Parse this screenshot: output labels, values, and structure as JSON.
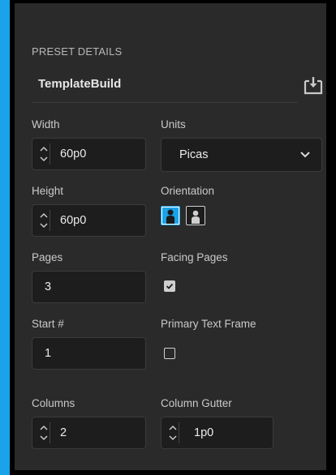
{
  "section": {
    "title": "PRESET DETAILS"
  },
  "preset": {
    "name": "TemplateBuild"
  },
  "width": {
    "label": "Width",
    "value": "60p0"
  },
  "units": {
    "label": "Units",
    "value": "Picas"
  },
  "height": {
    "label": "Height",
    "value": "60p0"
  },
  "orientation": {
    "label": "Orientation",
    "selected": "portrait"
  },
  "pages": {
    "label": "Pages",
    "value": "3"
  },
  "facing_pages": {
    "label": "Facing Pages",
    "checked": true
  },
  "start": {
    "label": "Start #",
    "value": "1"
  },
  "primary_text_frame": {
    "label": "Primary Text Frame",
    "checked": false
  },
  "columns": {
    "label": "Columns",
    "value": "2"
  },
  "column_gutter": {
    "label": "Column Gutter",
    "value": "1p0"
  },
  "colors": {
    "accent": "#1aa3e8",
    "panel": "#2a2a2a",
    "field": "#1d1d1d"
  },
  "icons": [
    "save-preset-icon",
    "stepper-icon",
    "chevron-down-icon",
    "portrait-icon",
    "landscape-icon",
    "checkbox-icon"
  ]
}
